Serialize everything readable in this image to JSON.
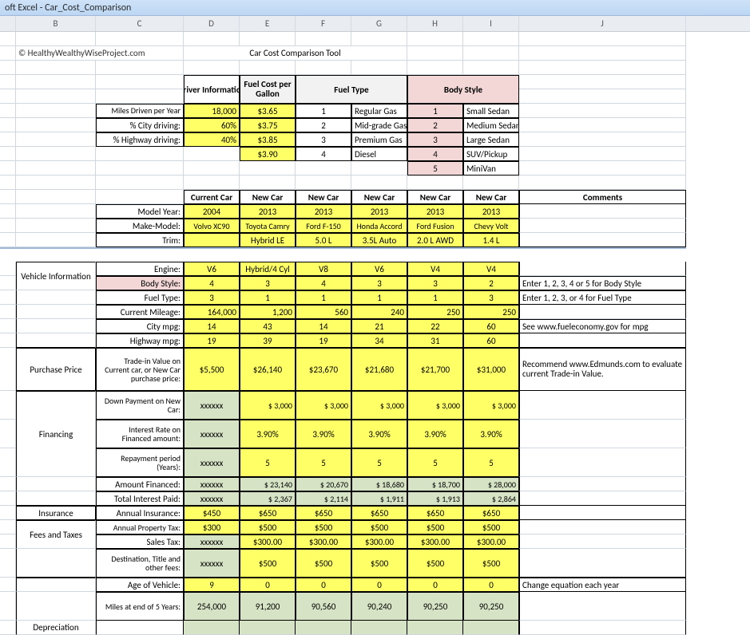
{
  "app_title": "oft Excel - Car_Cost_Comparison",
  "cols": [
    "B",
    "C",
    "D",
    "E",
    "F",
    "G",
    "H",
    "I",
    "J"
  ],
  "copyright": "© HealthyWealthyWiseProject.com",
  "page_title": "Car Cost Comparison Tool",
  "driver_header": "Driver Information",
  "fuel_cost_header": "Fuel Cost per Gallon",
  "fuel_type_header": "Fuel Type",
  "body_style_header": "Body Style",
  "driver_rows": {
    "miles_label": "Miles Driven per Year",
    "miles_val": "18,000",
    "city_label": "% City driving:",
    "city_val": "60%",
    "hwy_label": "% Highway driving:",
    "hwy_val": "40%"
  },
  "fuel_costs": [
    "$3.65",
    "$3.75",
    "$3.85",
    "$3.90"
  ],
  "fuel_type_nums": [
    "1",
    "2",
    "3",
    "4"
  ],
  "fuel_types": [
    "Regular Gas",
    "Mid-grade Gas",
    "Premium Gas",
    "Diesel"
  ],
  "body_nums": [
    "1",
    "2",
    "3",
    "4",
    "5"
  ],
  "body_styles": [
    "Small Sedan",
    "Medium Sedan",
    "Large Sedan",
    "SUV/Pickup",
    "MiniVan"
  ],
  "car_cols": [
    "Current Car",
    "New Car",
    "New Car",
    "New Car",
    "New Car",
    "New Car"
  ],
  "comments_hdr": "Comments",
  "row_labels": {
    "model_year": "Model Year:",
    "make_model": "Make-Model:",
    "trim": "Trim:",
    "engine": "Engine:",
    "body_style": "Body Style:",
    "fuel_type": "Fuel Type:",
    "cur_mileage": "Current Mileage:",
    "city_mpg": "City mpg:",
    "hwy_mpg": "Highway mpg:",
    "tradein": "Trade-in Value on Current car, or New Car purchase price:",
    "down": "Down Payment on New Car:",
    "rate": "Interest Rate on Financed amount:",
    "period": "Repayment period (Years):",
    "financed": "Amount Financed:",
    "interest": "Total Interest Paid:",
    "insurance": "Annual Insurance:",
    "proptax": "Annual Property Tax:",
    "salestax": "Sales Tax:",
    "dest": "Destination, Title and other fees:",
    "age": "Age of Vehicle:",
    "miles5": "Miles at end of 5 Years:"
  },
  "sections": {
    "vehicle": "Vehicle Information",
    "purchase": "Purchase Price",
    "financing": "Financing",
    "insurance_s": "Insurance",
    "fees": "Fees and Taxes",
    "depr": "Depreciation"
  },
  "data": {
    "model_year": [
      "2004",
      "2013",
      "2013",
      "2013",
      "2013",
      "2013"
    ],
    "make_model": [
      "Volvo XC90",
      "Toyota Camry",
      "Ford F-150",
      "Honda Accord",
      "Ford Fusion",
      "Chevy Volt"
    ],
    "trim": [
      "",
      "Hybrid LE",
      "5.0 L",
      "3.5L Auto",
      "2.0 L AWD",
      "1.4 L"
    ],
    "engine": [
      "V6",
      "Hybrid/4 Cyl",
      "V8",
      "V6",
      "V4",
      "V4"
    ],
    "body_style": [
      "4",
      "3",
      "4",
      "3",
      "3",
      "2"
    ],
    "fuel_type": [
      "3",
      "1",
      "1",
      "1",
      "1",
      "3"
    ],
    "cur_mileage": [
      "164,000",
      "1,200",
      "560",
      "240",
      "250",
      "250"
    ],
    "city_mpg": [
      "14",
      "43",
      "14",
      "21",
      "22",
      "60"
    ],
    "hwy_mpg": [
      "19",
      "39",
      "19",
      "34",
      "31",
      "60"
    ],
    "tradein": [
      "$5,500",
      "$26,140",
      "$23,670",
      "$21,680",
      "$21,700",
      "$31,000"
    ],
    "down": [
      "xxxxxx",
      "$      3,000",
      "$      3,000",
      "$      3,000",
      "$      3,000",
      "$      3,000"
    ],
    "rate": [
      "xxxxxx",
      "3.90%",
      "3.90%",
      "3.90%",
      "3.90%",
      "3.90%"
    ],
    "period": [
      "xxxxxx",
      "5",
      "5",
      "5",
      "5",
      "5"
    ],
    "financed": [
      "xxxxxx",
      "$    23,140",
      "$    20,670",
      "$    18,680",
      "$    18,700",
      "$    28,000"
    ],
    "interest": [
      "xxxxxx",
      "$      2,367",
      "$      2,114",
      "$      1,911",
      "$      1,913",
      "$      2,864"
    ],
    "insurance": [
      "$450",
      "$650",
      "$650",
      "$650",
      "$650",
      "$650"
    ],
    "proptax": [
      "$300",
      "$500",
      "$500",
      "$500",
      "$500",
      "$500"
    ],
    "salestax": [
      "xxxxxx",
      "$300.00",
      "$300.00",
      "$300.00",
      "$300.00",
      "$300.00"
    ],
    "dest": [
      "xxxxxx",
      "$500",
      "$500",
      "$500",
      "$500",
      "$500"
    ],
    "age": [
      "9",
      "0",
      "0",
      "0",
      "0",
      "0"
    ],
    "miles5": [
      "254,000",
      "91,200",
      "90,560",
      "90,240",
      "90,250",
      "90,250"
    ]
  },
  "comments": {
    "body_style": "Enter 1, 2, 3, 4 or 5 for Body Style",
    "fuel_type": "Enter 1, 2, 3, or 4 for Fuel Type",
    "city_mpg": "See www.fueleconomy.gov for mpg",
    "tradein": "Recommend www.Edmunds.com to evaluate current Trade-in Value.",
    "age": "Change equation each year"
  }
}
